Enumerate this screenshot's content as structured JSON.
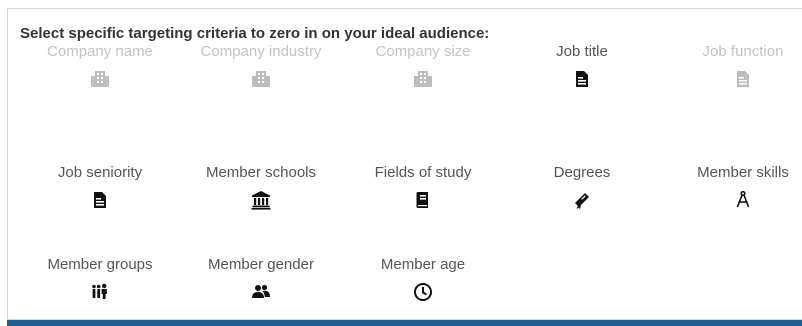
{
  "heading": "Select specific targeting criteria to zero in on your ideal audience:",
  "criteria": [
    {
      "label": "Company name",
      "icon": "building-icon",
      "enabled": false
    },
    {
      "label": "Company industry",
      "icon": "building-icon",
      "enabled": false
    },
    {
      "label": "Company size",
      "icon": "building-icon",
      "enabled": false
    },
    {
      "label": "Job title",
      "icon": "document-icon",
      "enabled": true
    },
    {
      "label": "Job function",
      "icon": "document-icon",
      "enabled": false
    },
    {
      "label": "Job seniority",
      "icon": "document-icon",
      "enabled": true
    },
    {
      "label": "Member schools",
      "icon": "institution-icon",
      "enabled": true
    },
    {
      "label": "Fields of study",
      "icon": "book-icon",
      "enabled": true
    },
    {
      "label": "Degrees",
      "icon": "diploma-icon",
      "enabled": true
    },
    {
      "label": "Member skills",
      "icon": "compass-icon",
      "enabled": true
    },
    {
      "label": "Member groups",
      "icon": "group-icon",
      "enabled": true
    },
    {
      "label": "Member gender",
      "icon": "users-icon",
      "enabled": true
    },
    {
      "label": "Member age",
      "icon": "clock-icon",
      "enabled": true
    }
  ],
  "colors": {
    "disabled_text": "#c3c3c3",
    "enabled_text": "#555555",
    "accent_bar": "#1a5e92"
  }
}
